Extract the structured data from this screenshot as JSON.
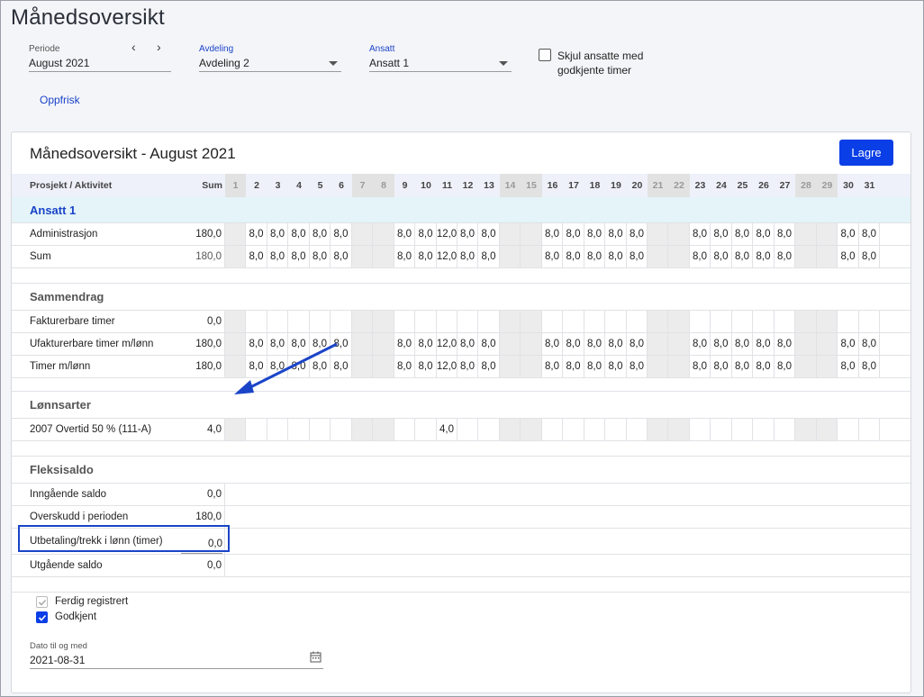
{
  "page_title": "Månedsoversikt",
  "filters": {
    "periode": {
      "label": "Periode",
      "value": "August 2021"
    },
    "avdeling": {
      "label": "Avdeling",
      "value": "Avdeling 2"
    },
    "ansatt": {
      "label": "Ansatt",
      "value": "Ansatt 1"
    },
    "hide_approved_label": "Skjul ansatte med godkjente timer",
    "prev_icon": "chevron-left-icon",
    "next_icon": "chevron-right-icon"
  },
  "refresh_label": "Oppfrisk",
  "card": {
    "title": "Månedsoversikt - August 2021",
    "save_label": "Lagre"
  },
  "grid": {
    "col_project": "Prosjekt / Aktivitet",
    "col_sum": "Sum",
    "days": [
      "1",
      "2",
      "3",
      "4",
      "5",
      "6",
      "7",
      "8",
      "9",
      "10",
      "11",
      "12",
      "13",
      "14",
      "15",
      "16",
      "17",
      "18",
      "19",
      "20",
      "21",
      "22",
      "23",
      "24",
      "25",
      "26",
      "27",
      "28",
      "29",
      "30",
      "31"
    ],
    "weekend_days": [
      1,
      7,
      8,
      14,
      15,
      21,
      22,
      28,
      29
    ],
    "group_name": "Ansatt 1",
    "rows_employee": [
      {
        "name": "Administrasjon",
        "sum": "180,0",
        "values": [
          "",
          "8,0",
          "8,0",
          "8,0",
          "8,0",
          "8,0",
          "",
          "",
          "8,0",
          "8,0",
          "12,0",
          "8,0",
          "8,0",
          "",
          "",
          "8,0",
          "8,0",
          "8,0",
          "8,0",
          "8,0",
          "",
          "",
          "8,0",
          "8,0",
          "8,0",
          "8,0",
          "8,0",
          "",
          "",
          "8,0",
          "8,0"
        ]
      },
      {
        "name": "Sum",
        "sum": "180,0",
        "values": [
          "",
          "8,0",
          "8,0",
          "8,0",
          "8,0",
          "8,0",
          "",
          "",
          "8,0",
          "8,0",
          "12,0",
          "8,0",
          "8,0",
          "",
          "",
          "8,0",
          "8,0",
          "8,0",
          "8,0",
          "8,0",
          "",
          "",
          "8,0",
          "8,0",
          "8,0",
          "8,0",
          "8,0",
          "",
          "",
          "8,0",
          "8,0"
        ]
      }
    ],
    "summary_title": "Sammendrag",
    "rows_summary": [
      {
        "name": "Fakturerbare timer",
        "sum": "0,0",
        "values": [
          "",
          "",
          "",
          "",
          "",
          "",
          "",
          "",
          "",
          "",
          "",
          "",
          "",
          "",
          "",
          "",
          "",
          "",
          "",
          "",
          "",
          "",
          "",
          "",
          "",
          "",
          "",
          "",
          "",
          "",
          ""
        ]
      },
      {
        "name": "Ufakturerbare timer m/lønn",
        "sum": "180,0",
        "values": [
          "",
          "8,0",
          "8,0",
          "8,0",
          "8,0",
          "8,0",
          "",
          "",
          "8,0",
          "8,0",
          "12,0",
          "8,0",
          "8,0",
          "",
          "",
          "8,0",
          "8,0",
          "8,0",
          "8,0",
          "8,0",
          "",
          "",
          "8,0",
          "8,0",
          "8,0",
          "8,0",
          "8,0",
          "",
          "",
          "8,0",
          "8,0"
        ]
      },
      {
        "name": "Timer m/lønn",
        "sum": "180,0",
        "values": [
          "",
          "8,0",
          "8,0",
          "8,0",
          "8,0",
          "8,0",
          "",
          "",
          "8,0",
          "8,0",
          "12,0",
          "8,0",
          "8,0",
          "",
          "",
          "8,0",
          "8,0",
          "8,0",
          "8,0",
          "8,0",
          "",
          "",
          "8,0",
          "8,0",
          "8,0",
          "8,0",
          "8,0",
          "",
          "",
          "8,0",
          "8,0"
        ]
      }
    ],
    "wage_title": "Lønnsarter",
    "rows_wage": [
      {
        "name": "2007 Overtid 50 % (111-A)",
        "sum": "4,0",
        "values": [
          "",
          "",
          "",
          "",
          "",
          "",
          "",
          "",
          "",
          "",
          "4,0",
          "",
          "",
          "",
          "",
          "",
          "",
          "",
          "",
          "",
          "",
          "",
          "",
          "",
          "",
          "",
          "",
          "",
          "",
          "",
          ""
        ]
      }
    ],
    "flex_title": "Fleksisaldo",
    "rows_flex": [
      {
        "name": "Inngående saldo",
        "sum": "0,0"
      },
      {
        "name": "Overskudd i perioden",
        "sum": "180,0"
      },
      {
        "name": "Utbetaling/trekk i lønn (timer)",
        "sum": "0,0",
        "editable": true
      },
      {
        "name": "Utgående saldo",
        "sum": "0,0"
      }
    ]
  },
  "status": {
    "ferdig_label": "Ferdig registrert",
    "ferdig_checked": true,
    "godkjent_label": "Godkjent",
    "godkjent_checked": true
  },
  "date_field": {
    "label": "Dato til og med",
    "value": "2021-08-31",
    "icon": "calendar-icon"
  },
  "colors": {
    "accent": "#0a3ee6",
    "highlight": "#1a44c8",
    "group_bg": "#e4f4f8",
    "weekend_bg": "#ececec"
  }
}
